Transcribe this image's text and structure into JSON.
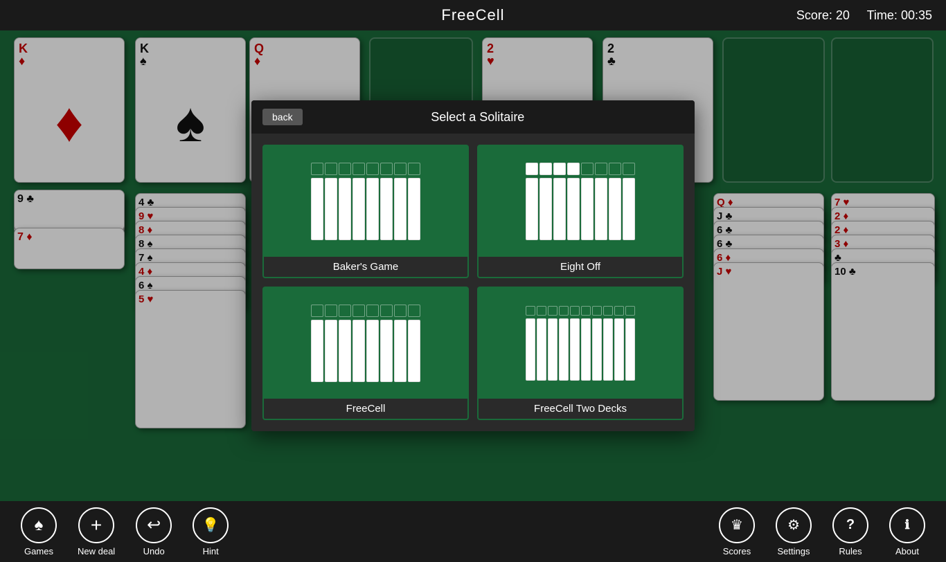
{
  "header": {
    "title": "FreeCell",
    "score_label": "Score:",
    "score_value": "20",
    "time_label": "Time:",
    "time_value": "00:35"
  },
  "toolbar": {
    "left_buttons": [
      {
        "id": "games",
        "label": "Games",
        "icon": "♠"
      },
      {
        "id": "new-deal",
        "label": "New deal",
        "icon": "+"
      },
      {
        "id": "undo",
        "label": "Undo",
        "icon": "↩"
      },
      {
        "id": "hint",
        "label": "Hint",
        "icon": "💡"
      }
    ],
    "right_buttons": [
      {
        "id": "scores",
        "label": "Scores",
        "icon": "♛"
      },
      {
        "id": "settings",
        "label": "Settings",
        "icon": "⚙"
      },
      {
        "id": "rules",
        "label": "Rules",
        "icon": "?"
      },
      {
        "id": "about",
        "label": "About",
        "icon": "ℹ"
      }
    ]
  },
  "modal": {
    "back_label": "back",
    "title": "Select a Solitaire",
    "options": [
      {
        "id": "bakers-game",
        "label": "Baker's Game"
      },
      {
        "id": "eight-off",
        "label": "Eight Off"
      },
      {
        "id": "freecell",
        "label": "FreeCell"
      },
      {
        "id": "freecell-two-decks",
        "label": "FreeCell Two Decks"
      }
    ]
  },
  "cards": {
    "top_row": [
      {
        "rank": "K",
        "suit": "♦",
        "color": "red"
      },
      {
        "rank": "K",
        "suit": "♠",
        "color": "black"
      },
      {
        "rank": "Q",
        "suit": "♦",
        "color": "red"
      },
      {
        "rank": "",
        "suit": "",
        "color": ""
      },
      {
        "rank": "2",
        "suit": "♥",
        "color": "red"
      },
      {
        "rank": "2",
        "suit": "♣",
        "color": "black"
      },
      {
        "rank": "",
        "suit": "",
        "color": ""
      },
      {
        "rank": "",
        "suit": "",
        "color": ""
      }
    ]
  }
}
